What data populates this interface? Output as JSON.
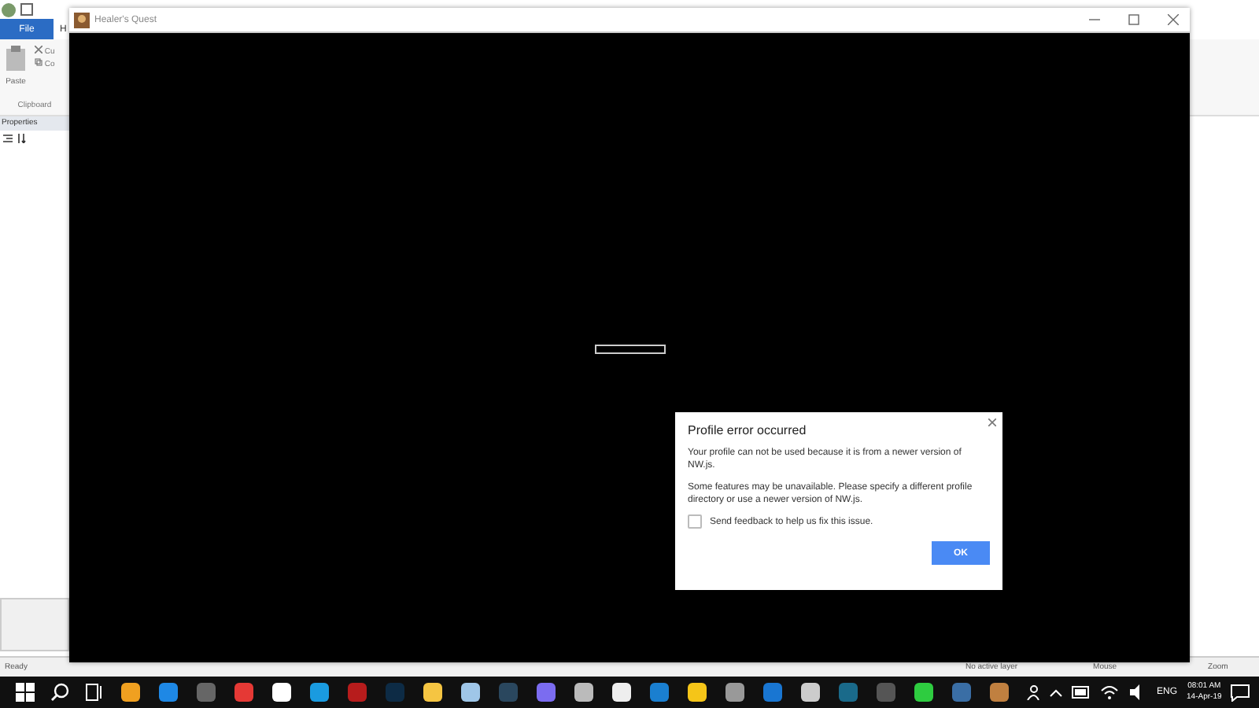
{
  "ribbon": {
    "tabs": [
      {
        "label": "File",
        "selected": true
      },
      {
        "label": "H",
        "selected": false
      }
    ],
    "paste": "Paste",
    "cut": "Cu",
    "copy": "Co",
    "group": "Clipboard"
  },
  "properties_panel": {
    "title": "Properties"
  },
  "status_bar": {
    "status": "Ready",
    "layer": "No active layer",
    "mouse": "Mouse",
    "zoom": "Zoom"
  },
  "game_window": {
    "title": "Healer's Quest",
    "loading_bar": {
      "level": 0
    }
  },
  "dialog": {
    "title": "Profile error occurred",
    "message": "Your profile can not be used because it is from a newer version of NW.js.",
    "detail": "Some features may be unavailable. Please specify a different profile directory or use a newer version of NW.js.",
    "feedback": {
      "label": "Send feedback to help us fix this issue.",
      "checked": false
    },
    "ok": "OK"
  },
  "taskbar": {
    "language": "ENG",
    "time": "08:01 AM",
    "date": "14-Apr-19"
  }
}
